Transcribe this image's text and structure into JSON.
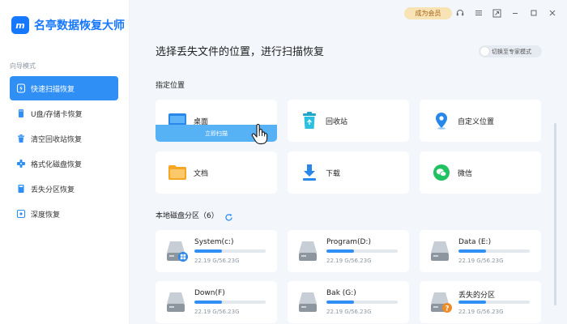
{
  "app": {
    "logo_mark": "m",
    "name": "名亭数据恢复大师",
    "vip_label": "成为会员",
    "brand_color": "#1677ff"
  },
  "window_controls": [
    "headset-icon",
    "menu-icon",
    "feedback-icon",
    "minimize-icon",
    "maximize-icon",
    "close-icon"
  ],
  "sidebar": {
    "section_label": "向导模式",
    "items": [
      {
        "label": "快速扫描恢复",
        "icon": "lightning-icon",
        "active": true
      },
      {
        "label": "U盘/存储卡恢复",
        "icon": "usb-icon",
        "active": false
      },
      {
        "label": "清空回收站恢复",
        "icon": "trash-icon",
        "active": false
      },
      {
        "label": "格式化磁盘恢复",
        "icon": "format-icon",
        "active": false
      },
      {
        "label": "丢失分区恢复",
        "icon": "partition-icon",
        "active": false
      },
      {
        "label": "深度恢复",
        "icon": "deep-scan-icon",
        "active": false
      }
    ]
  },
  "main": {
    "title": "选择丢失文件的位置，进行扫描恢复",
    "expert_toggle": "切换至专家模式",
    "locations_title": "指定位置",
    "locations": [
      {
        "label": "桌面",
        "icon": "desktop-folder-icon",
        "scan_label": "立即扫描"
      },
      {
        "label": "回收站",
        "icon": "recycle-bin-icon"
      },
      {
        "label": "自定义位置",
        "icon": "location-pin-icon"
      },
      {
        "label": "文档",
        "icon": "documents-folder-icon"
      },
      {
        "label": "下载",
        "icon": "download-icon"
      },
      {
        "label": "微信",
        "icon": "wechat-icon"
      }
    ],
    "disks_title": "本地磁盘分区（6）",
    "disks": [
      {
        "name": "System(c:)",
        "size": "22.19 G/56.23G",
        "used_fraction": 0.39,
        "badge": "windows"
      },
      {
        "name": "Program(D:)",
        "size": "22.19 G/56.23G",
        "used_fraction": 0.39,
        "badge": ""
      },
      {
        "name": "Data (E:)",
        "size": "22.19 G/56.23G",
        "used_fraction": 0.39,
        "badge": ""
      },
      {
        "name": "Down(F)",
        "size": "22.19 G/56.23G",
        "used_fraction": 0.39,
        "badge": ""
      },
      {
        "name": "Bak (G:)",
        "size": "22.19 G/56.23G",
        "used_fraction": 0.39,
        "badge": ""
      },
      {
        "name": "丢失的分区",
        "size": "22.19 G/56.23G",
        "used_fraction": 0.39,
        "badge": "lost"
      }
    ]
  }
}
